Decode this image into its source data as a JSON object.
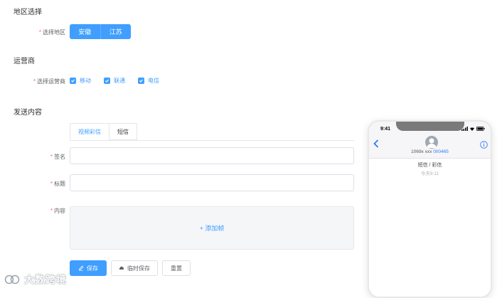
{
  "region": {
    "section_title": "地区选择",
    "label": "选择地区",
    "options": [
      "安徽",
      "江苏"
    ]
  },
  "carrier": {
    "section_title": "运营商",
    "label": "选择运营商",
    "options": [
      {
        "label": "移动",
        "checked": true
      },
      {
        "label": "联通",
        "checked": true
      },
      {
        "label": "电信",
        "checked": true
      }
    ]
  },
  "content": {
    "section_title": "发送内容",
    "tabs": [
      {
        "label": "视频彩信",
        "active": true
      },
      {
        "label": "短信",
        "active": false
      }
    ],
    "signature_label": "签名",
    "title_label": "标题",
    "content_label": "内容",
    "add_frame_label": "+ 添加帧"
  },
  "actions": {
    "save": "保存",
    "temp_save": "临时保存",
    "reset": "重置"
  },
  "phone": {
    "time": "9:41",
    "sender_prefix": "1069x xxx",
    "sender_suffix": "000465",
    "message_type": "短信 / 彩信",
    "message_time": "今天9:11"
  },
  "watermark": {
    "text": "大数跨境"
  },
  "colors": {
    "primary": "#409eff",
    "required": "#f56c6c",
    "border": "#dcdfe6"
  }
}
